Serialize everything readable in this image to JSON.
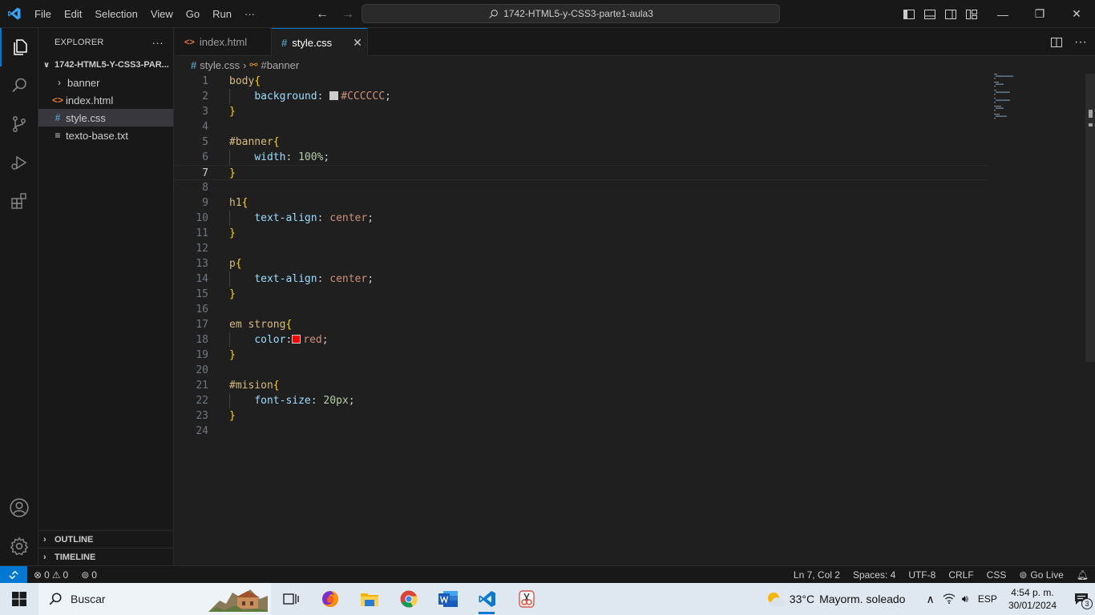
{
  "titlebar": {
    "menu": [
      "File",
      "Edit",
      "Selection",
      "View",
      "Go",
      "Run",
      "···"
    ],
    "search_text": "1742-HTML5-y-CSS3-parte1-aula3"
  },
  "explorer": {
    "title": "EXPLORER",
    "more": "···",
    "folder": "1742-HTML5-Y-CSS3-PAR...",
    "items": [
      {
        "label": "banner",
        "type": "folder"
      },
      {
        "label": "index.html",
        "type": "html"
      },
      {
        "label": "style.css",
        "type": "css",
        "selected": true
      },
      {
        "label": "texto-base.txt",
        "type": "txt"
      }
    ],
    "outline": "OUTLINE",
    "timeline": "TIMELINE"
  },
  "tabs": [
    {
      "label": "index.html",
      "icon": "html-icon",
      "active": false
    },
    {
      "label": "style.css",
      "icon": "css-icon",
      "active": true
    }
  ],
  "breadcrumb": {
    "file": "style.css",
    "symbol": "#banner"
  },
  "code": {
    "current_line": 7,
    "lines": [
      "body{",
      "    background: #CCCCCC;",
      "}",
      "",
      "#banner{",
      "    width: 100%;",
      "}",
      "",
      "h1{",
      "    text-align: center;",
      "}",
      "",
      "p{",
      "    text-align: center;",
      "}",
      "",
      "em strong{",
      "    color: red;",
      "}",
      "",
      "#mision{",
      "    font-size: 20px;",
      "}",
      ""
    ],
    "swatches": {
      "2": "#CCCCCC",
      "18": "#ff0000"
    }
  },
  "statusbar": {
    "errors": "0",
    "warnings": "0",
    "ports": "0",
    "position": "Ln 7, Col 2",
    "spaces": "Spaces: 4",
    "encoding": "UTF-8",
    "eol": "CRLF",
    "language": "CSS",
    "golive": "Go Live"
  },
  "taskbar": {
    "search": "Buscar",
    "weather_temp": "33°C",
    "weather_desc": "Mayorm. soleado",
    "lang": "ESP",
    "time": "4:54 p. m.",
    "date": "30/01/2024",
    "notifications": "3"
  },
  "colors": {
    "accent": "#0078d4",
    "editor_bg": "#1f1f1f",
    "chrome_bg": "#181818"
  }
}
